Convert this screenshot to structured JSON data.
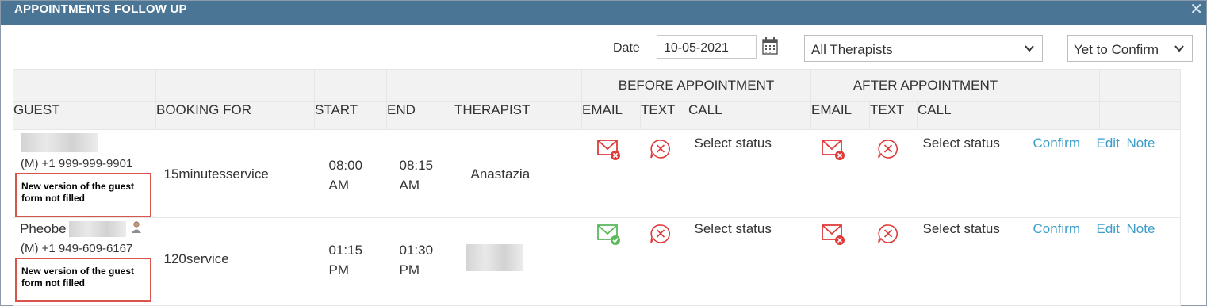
{
  "window": {
    "title": "APPOINTMENTS FOLLOW UP"
  },
  "filters": {
    "date_label": "Date",
    "date_value": "10-05-2021",
    "therapist_select": "All Therapists",
    "status_select": "Yet to Confirm"
  },
  "table": {
    "groups": {
      "before": "BEFORE APPOINTMENT",
      "after": "AFTER APPOINTMENT"
    },
    "columns": {
      "guest": "GUEST",
      "booking_for": "BOOKING FOR",
      "start": "START",
      "end": "END",
      "therapist": "THERAPIST",
      "email": "EMAIL",
      "text": "TEXT",
      "call": "CALL"
    },
    "rows": [
      {
        "guest_name": "",
        "phone": "(M) +1 999-999-9901",
        "notice": "New version of the guest form not filled",
        "booking_for": "15minutesservice",
        "start_time": "08:00",
        "start_ampm": "AM",
        "end_time": "08:15",
        "end_ampm": "AM",
        "therapist": "Anastazia",
        "before_email_status": "failed",
        "after_email_status": "failed",
        "call_status_before": "Select status",
        "call_status_after": "Select status",
        "actions": {
          "confirm": "Confirm",
          "edit": "Edit",
          "note": "Note"
        }
      },
      {
        "guest_name": "Pheobe",
        "phone": "(M) +1 949-609-6167",
        "notice": "New version of the guest form not filled",
        "booking_for": "120service",
        "start_time": "01:15",
        "start_ampm": "PM",
        "end_time": "01:30",
        "end_ampm": "PM",
        "therapist": "",
        "before_email_status": "sent",
        "after_email_status": "failed",
        "call_status_before": "Select status",
        "call_status_after": "Select status",
        "actions": {
          "confirm": "Confirm",
          "edit": "Edit",
          "note": "Note"
        }
      }
    ]
  },
  "colors": {
    "titlebar": "#4a7594",
    "link": "#3b9dc9",
    "error": "#e03b3b",
    "success": "#5cb85c",
    "notice_border": "#d9534f"
  },
  "icons": [
    "close-icon",
    "calendar-icon",
    "chevron-down-icon",
    "email-failed-icon",
    "email-sent-icon",
    "text-failed-icon",
    "person-icon"
  ]
}
